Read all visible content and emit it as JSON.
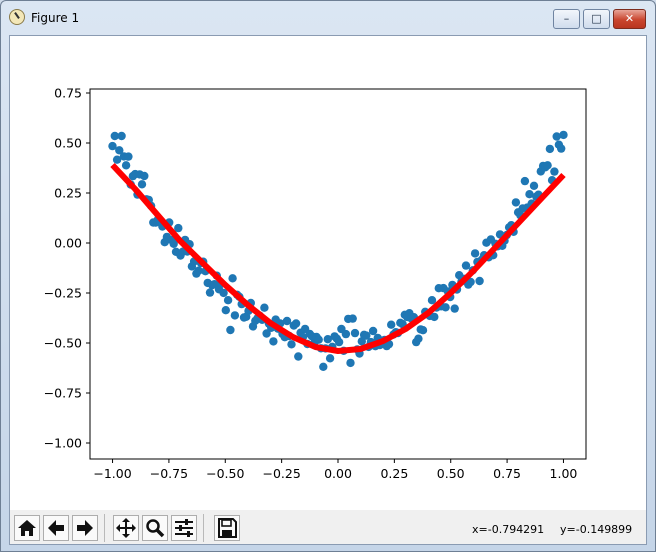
{
  "window": {
    "title": "Figure 1",
    "minimize_glyph": "–",
    "maximize_glyph": "□",
    "close_glyph": "✕"
  },
  "toolbar": {
    "buttons": [
      {
        "name": "home-button",
        "icon": "home-icon"
      },
      {
        "name": "back-button",
        "icon": "arrow-left-icon"
      },
      {
        "name": "forward-button",
        "icon": "arrow-right-icon"
      },
      {
        "name": "pan-button",
        "icon": "move-icon"
      },
      {
        "name": "zoom-button",
        "icon": "zoom-icon"
      },
      {
        "name": "configure-subplots-button",
        "icon": "sliders-icon"
      },
      {
        "name": "save-button",
        "icon": "floppy-icon"
      }
    ],
    "coord_x": "x=-0.794291",
    "coord_y": "y=-0.149899"
  },
  "chart_data": {
    "type": "scatter",
    "title": "",
    "xlabel": "",
    "ylabel": "",
    "xlim": [
      -1.1,
      1.1
    ],
    "ylim": [
      -1.08,
      0.77
    ],
    "xticks": [
      "−1.00",
      "−0.75",
      "−0.50",
      "−0.25",
      "0.00",
      "0.25",
      "0.50",
      "0.75",
      "1.00"
    ],
    "xtick_values": [
      -1.0,
      -0.75,
      -0.5,
      -0.25,
      0.0,
      0.25,
      0.5,
      0.75,
      1.0
    ],
    "yticks": [
      "0.75",
      "0.50",
      "0.25",
      "0.00",
      "−0.25",
      "−0.50",
      "−0.75",
      "−1.00"
    ],
    "ytick_values": [
      0.75,
      0.5,
      0.25,
      0.0,
      -0.25,
      -0.5,
      -0.75,
      -1.0
    ],
    "grid": false,
    "series": [
      {
        "kind": "scatter",
        "color": "#1f77b4",
        "n_points": 200,
        "x_range": [
          -1.0,
          1.0
        ],
        "approx_trend": "y ≈ x² − 0.5 + noise (σ≈0.05)"
      },
      {
        "kind": "line",
        "color": "#ff0000",
        "x": [
          -1.0,
          -0.9,
          -0.8,
          -0.7,
          -0.6,
          -0.5,
          -0.4,
          -0.3,
          -0.2,
          -0.1,
          0.0,
          0.1,
          0.2,
          0.3,
          0.4,
          0.5,
          0.6,
          0.7,
          0.8,
          0.9,
          1.0
        ],
        "y": [
          0.39,
          0.27,
          0.14,
          0.01,
          -0.1,
          -0.21,
          -0.31,
          -0.4,
          -0.47,
          -0.52,
          -0.54,
          -0.53,
          -0.49,
          -0.43,
          -0.35,
          -0.25,
          -0.14,
          -0.02,
          0.1,
          0.22,
          0.34
        ]
      }
    ]
  }
}
